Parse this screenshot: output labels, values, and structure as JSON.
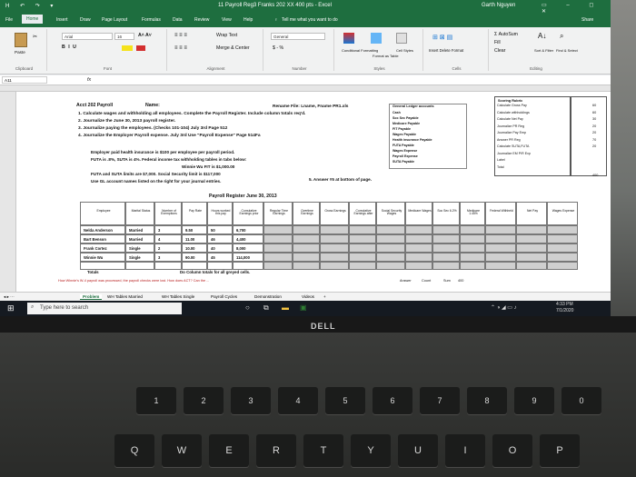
{
  "title_bar": {
    "quick_access": "H ↶ ↷ ▾",
    "title": "11 Payroll Reg3 Franks 202 XX 400 pts - Excel",
    "user": "Garth Nguyen",
    "window_controls": "▭ – ◻ ✕"
  },
  "menu": {
    "items": [
      "File",
      "Home",
      "Insert",
      "Draw",
      "Page Layout",
      "Formulas",
      "Data",
      "Review",
      "View",
      "Help"
    ],
    "tell_me": "Tell me what you want to do",
    "share": "Share"
  },
  "ribbon": {
    "paste": "Paste",
    "clipboard": "Clipboard",
    "font_name": "Arial",
    "font_size": "16",
    "bold_italic_underline": "B  I  U",
    "font": "Font",
    "wrap_text": "Wrap Text",
    "merge_center": "Merge & Center",
    "alignment": "Alignment",
    "number_format": "General",
    "number_symbols": "$  -  %",
    "number": "Number",
    "conditional": "Conditional Formatting",
    "format_table": "Format as Table",
    "cell_styles": "Cell Styles",
    "styles": "Styles",
    "insert_delete_format": "Insert  Delete  Format",
    "cells": "Cells",
    "autosum": "Σ AutoSum",
    "fill": "Fill",
    "clear": "Clear",
    "sort_filter": "Sort & Filter",
    "find_select": "Find & Select",
    "editing": "Editing"
  },
  "formula_bar": {
    "name_box": "A11",
    "fx": "fx",
    "value": ""
  },
  "sheet": {
    "acct_title": "Acct 202 Payroll",
    "name_label": "Name:",
    "rename_file": "Rename File: Lname, Fname PR1.xls",
    "instructions": [
      "1. Calculate wages and withholding all employees. Complete the Payroll Register. Include column totals req'd.",
      "2. Journalize the June 30, 2013 payroll register.",
      "3. Journalize paying the employees. (Checks 101-104) July 3rd Page 512",
      "4. Journalize the Employer Payroll expense. July 3rd Use \"Payroll Expense\" Page 514Fa"
    ],
    "employer_notes": [
      "Employer paid health insurance is $100 per employee per payroll period.",
      "FUTA is .8%, SUTA is 4%.  Federal income tax withholding tables in tabs below:",
      "Winnie Wu FIT is $1,000.00",
      "FUTA and SUTA limits are $7,000. Social Security limit is $117,000",
      "Use GL account names listed on the right for your journal entries."
    ],
    "answer_note": "5. Answer #5 at bottom of page.",
    "register_title": "Payroll Register June 30, 2013",
    "headers": [
      "Employee",
      "Marital Status",
      "Number of Exemptions",
      "Pay Rate",
      "Hours worked this pay",
      "Cumulative Earnings prior",
      "Regular Time Earnings",
      "Overtime Earnings",
      "Gross Earnings",
      "Cumulative Earnings after",
      "Social Security Wages",
      "Medicare Wages",
      "Soc Sec 6.2%",
      "Medicare 1.45%",
      "Federal Withheld",
      "Net Pay",
      "Wages Expense"
    ],
    "rows": [
      {
        "name": "Nelda Anderson",
        "status": "Married",
        "exemptions": "3",
        "rate": "9.50",
        "hours": "50",
        "cumulative": "6,700"
      },
      {
        "name": "Bart Benson",
        "status": "Married",
        "exemptions": "4",
        "rate": "11.00",
        "hours": "46",
        "cumulative": "4,400"
      },
      {
        "name": "Frank Cortez",
        "status": "Single",
        "exemptions": "2",
        "rate": "10.00",
        "hours": "40",
        "cumulative": "8,000"
      },
      {
        "name": "Winnie Wu",
        "status": "Single",
        "exemptions": "3",
        "rate": "90.00",
        "hours": "45",
        "cumulative": "114,000"
      }
    ],
    "totals_label": "Totals",
    "do_columns_note": "Do Column totals for all greyed cells.",
    "bottom_note": "How Winnie's W-4 payroll was processed, the payroll checks were lost.  How does ACT? Can the ...",
    "gl_accounts_title": "General Ledger accounts",
    "gl_accounts": [
      "Cash",
      "Soc Sec Payable",
      "Medicare Payable",
      "FIT Payable",
      "Wages Payable",
      "Health insurance Payable",
      "FUTA Payable",
      "Wages Expense",
      "Payroll Expense",
      "SUTA Payable"
    ],
    "side_options_title": "Scoring Rubric",
    "side_options": [
      "Calculate Gross Pay",
      "Calculate withholdings",
      "Calculate Net Pay",
      "Journalize PR Reg",
      "Journalize Pay Emp",
      "Answer PR Reg",
      "Calculate SUTA,FUTA",
      "Journalize EM P/R Exp",
      "Label",
      "Total"
    ],
    "side_points": [
      "60",
      "60",
      "30",
      "20",
      "20",
      "70",
      "20",
      "400"
    ],
    "bottom_row_labels": [
      "Answer",
      "Count",
      "Sum",
      "400"
    ]
  },
  "sheet_tabs": [
    "Problem",
    "WH Tables Married",
    "WH Tables Single",
    "Payroll Cycles",
    "Demonstration",
    "Videos",
    "+"
  ],
  "taskbar": {
    "search_placeholder": "Type here to search",
    "time": "4:33 PM",
    "date": "7/1/2020"
  },
  "laptop": {
    "brand": "DELL",
    "keys_row1": [
      "1",
      "2",
      "3",
      "4",
      "5",
      "6",
      "7",
      "8",
      "9",
      "0"
    ],
    "keys_row2": [
      "Q",
      "W",
      "E",
      "R",
      "T",
      "Y",
      "U",
      "I",
      "O",
      "P"
    ]
  }
}
